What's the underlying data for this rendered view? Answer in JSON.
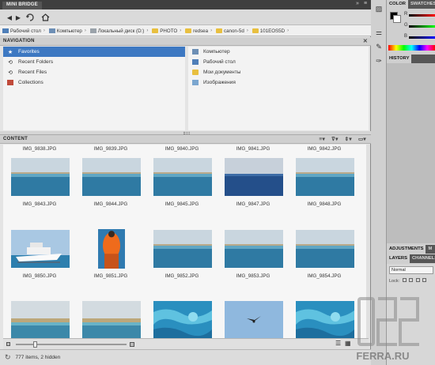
{
  "panel": {
    "tab_label": "MINI BRIDGE"
  },
  "breadcrumb": [
    {
      "label": "Рабочий стол",
      "icon": "desktop-icon"
    },
    {
      "label": "Компьютер",
      "icon": "computer-icon"
    },
    {
      "label": "Локальный диск (D:)",
      "icon": "drive-icon"
    },
    {
      "label": "PHOTO",
      "icon": "folder-icon"
    },
    {
      "label": "redsea",
      "icon": "folder-icon"
    },
    {
      "label": "canon-5d",
      "icon": "folder-icon"
    },
    {
      "label": "101EOS5D",
      "icon": "folder-icon"
    }
  ],
  "navigation": {
    "title": "NAVIGATION",
    "left_items": [
      {
        "label": "Favorites",
        "icon": "star-icon",
        "selected": true
      },
      {
        "label": "Recent Folders",
        "icon": "recent-folders-icon",
        "selected": false
      },
      {
        "label": "Recent Files",
        "icon": "recent-files-icon",
        "selected": false
      },
      {
        "label": "Collections",
        "icon": "collections-icon",
        "selected": false
      }
    ],
    "right_items": [
      {
        "label": "Компьютер",
        "icon": "computer-icon"
      },
      {
        "label": "Рабочий стол",
        "icon": "desktop-icon"
      },
      {
        "label": "Мои документы",
        "icon": "folder-icon"
      },
      {
        "label": "Изображения",
        "icon": "pictures-icon"
      }
    ]
  },
  "content": {
    "title": "CONTENT",
    "top_row_names": [
      "IMG_9838.JPG",
      "IMG_9839.JPG",
      "IMG_9840.JPG",
      "IMG_9841.JPG",
      "IMG_9842.JPG"
    ],
    "rows": [
      {
        "thumbs": [
          "sea",
          "sea",
          "sea",
          "seadark",
          "sea"
        ],
        "names": [
          "IMG_9843.JPG",
          "IMG_9844.JPG",
          "IMG_9845.JPG",
          "IMG_9847.JPG",
          "IMG_9848.JPG"
        ]
      },
      {
        "thumbs": [
          "boat",
          "person",
          "sea",
          "sea",
          "sea"
        ],
        "names": [
          "IMG_9850.JPG",
          "IMG_9851.JPG",
          "IMG_9852.JPG",
          "IMG_9853.JPG",
          "IMG_9854.JPG"
        ]
      },
      {
        "thumbs": [
          "beach",
          "beach",
          "water",
          "bird",
          "water"
        ],
        "names": [
          "IMG_9855.JPG",
          "IMG_9856.JPG",
          "IMG_9857.JPG",
          "IMG_9858.JPG",
          "IMG_9859.JPG"
        ]
      }
    ]
  },
  "status": {
    "text": "777 items, 2 hidden"
  },
  "dock": {
    "color_tabs": [
      "COLOR",
      "SWATCHES"
    ],
    "history_tab": "HISTORY",
    "adjust_tabs": [
      "ADJUSTMENTS",
      "M"
    ],
    "layers_tabs": [
      "LAYERS",
      "CHANNELS"
    ],
    "channels": [
      "R",
      "G",
      "B"
    ],
    "blend_mode": "Normal",
    "lock_label": "Lock:"
  },
  "watermark": {
    "text": "FERRA.RU"
  }
}
